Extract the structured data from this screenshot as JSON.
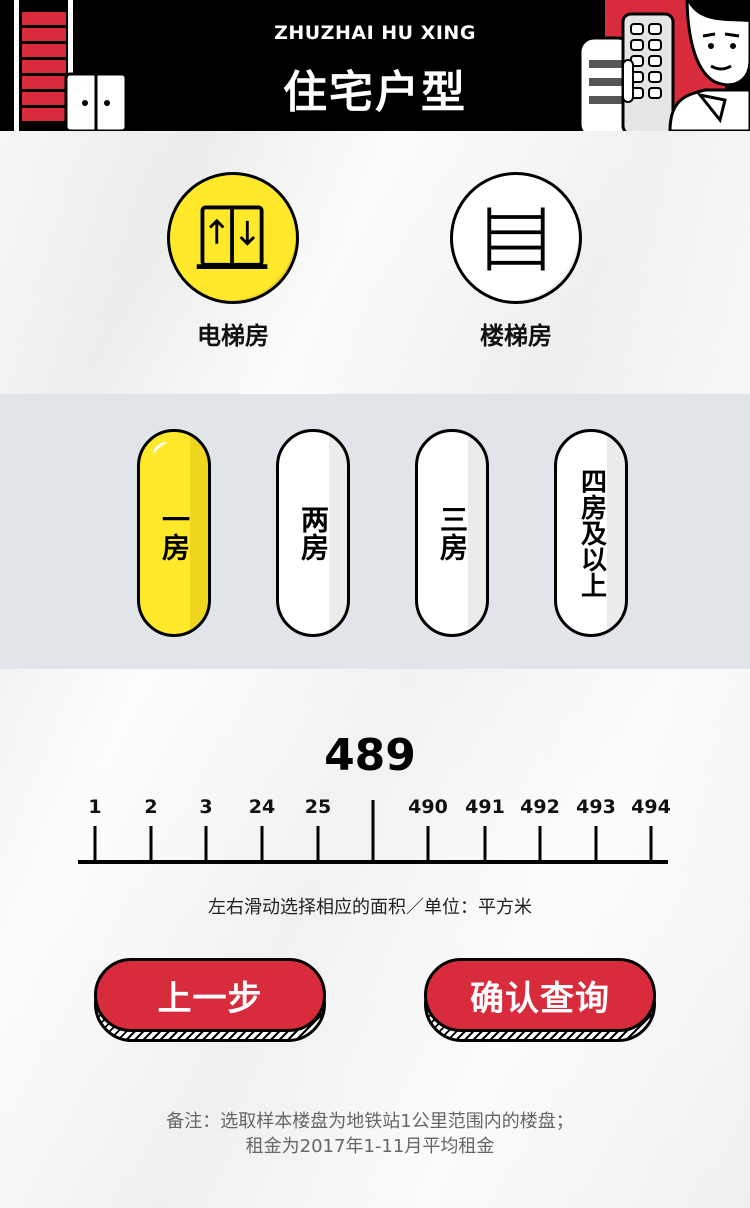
{
  "header": {
    "subtitle": "ZHUZHAI  HU  XING",
    "title": "住宅户型"
  },
  "building_types": [
    {
      "label": "电梯房",
      "icon": "elevator-icon",
      "selected": true
    },
    {
      "label": "楼梯房",
      "icon": "ladder-icon",
      "selected": false
    }
  ],
  "rooms": [
    {
      "label": "一房",
      "selected": true
    },
    {
      "label": "两房",
      "selected": false
    },
    {
      "label": "三房",
      "selected": false
    },
    {
      "label": "四房及以上",
      "selected": false
    }
  ],
  "area": {
    "value": "489",
    "ticks": [
      "1",
      "2",
      "3",
      "24",
      "25",
      "",
      "490",
      "491",
      "492",
      "493",
      "494"
    ],
    "hint": "左右滑动选择相应的面积／单位：平方米"
  },
  "buttons": {
    "prev": "上一步",
    "confirm": "确认查询"
  },
  "notes": {
    "line1": "备注：选取样本楼盘为地铁站1公里范围内的楼盘；",
    "line2": "租金为2017年1-11月平均租金"
  },
  "colors": {
    "accent_yellow": "#ffe92a",
    "accent_red": "#d82c3c",
    "band_gray": "#e1e4e8"
  }
}
